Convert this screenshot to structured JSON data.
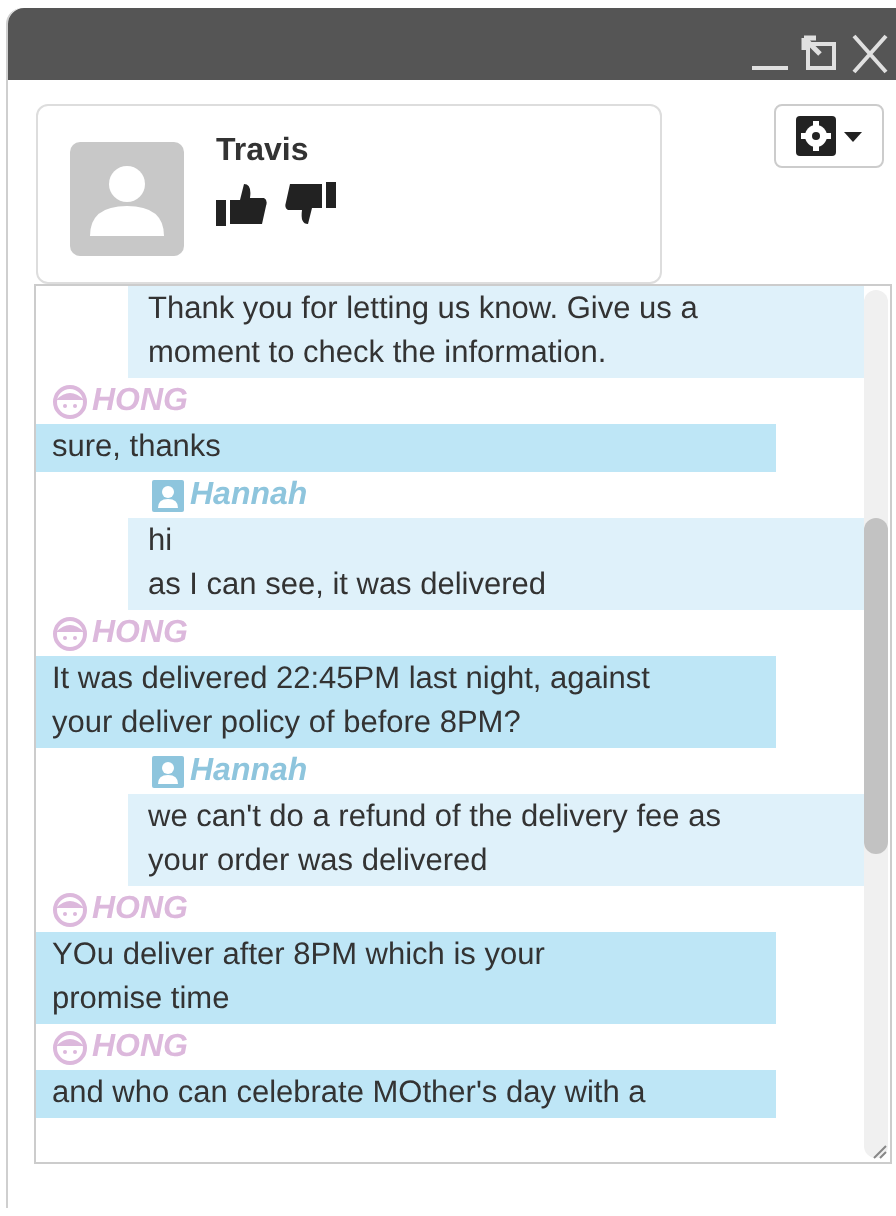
{
  "contact": {
    "name": "Travis"
  },
  "chat": [
    {
      "kind": "agent_message",
      "lines": [
        "Thank you for letting us know. Give us a",
        "moment to check the information."
      ]
    },
    {
      "kind": "customer_sender",
      "name": "HONG"
    },
    {
      "kind": "customer_message",
      "lines": [
        "sure, thanks"
      ]
    },
    {
      "kind": "agent_sender",
      "name": "Hannah"
    },
    {
      "kind": "agent_message",
      "lines": [
        "hi",
        "as I can see, it was delivered"
      ]
    },
    {
      "kind": "customer_sender",
      "name": "HONG"
    },
    {
      "kind": "customer_message",
      "lines": [
        "It was delivered 22:45PM last night, against",
        "your deliver policy of before 8PM?"
      ]
    },
    {
      "kind": "agent_sender",
      "name": "Hannah"
    },
    {
      "kind": "agent_message",
      "lines": [
        "we can't do a refund of the delivery fee as",
        "your order was delivered"
      ]
    },
    {
      "kind": "customer_sender",
      "name": "HONG"
    },
    {
      "kind": "customer_message",
      "lines": [
        "YOu deliver after 8PM which is your",
        "promise time"
      ]
    },
    {
      "kind": "customer_sender",
      "name": "HONG"
    },
    {
      "kind": "customer_message",
      "lines": [
        "and who can celebrate MOther's day with a"
      ]
    }
  ]
}
